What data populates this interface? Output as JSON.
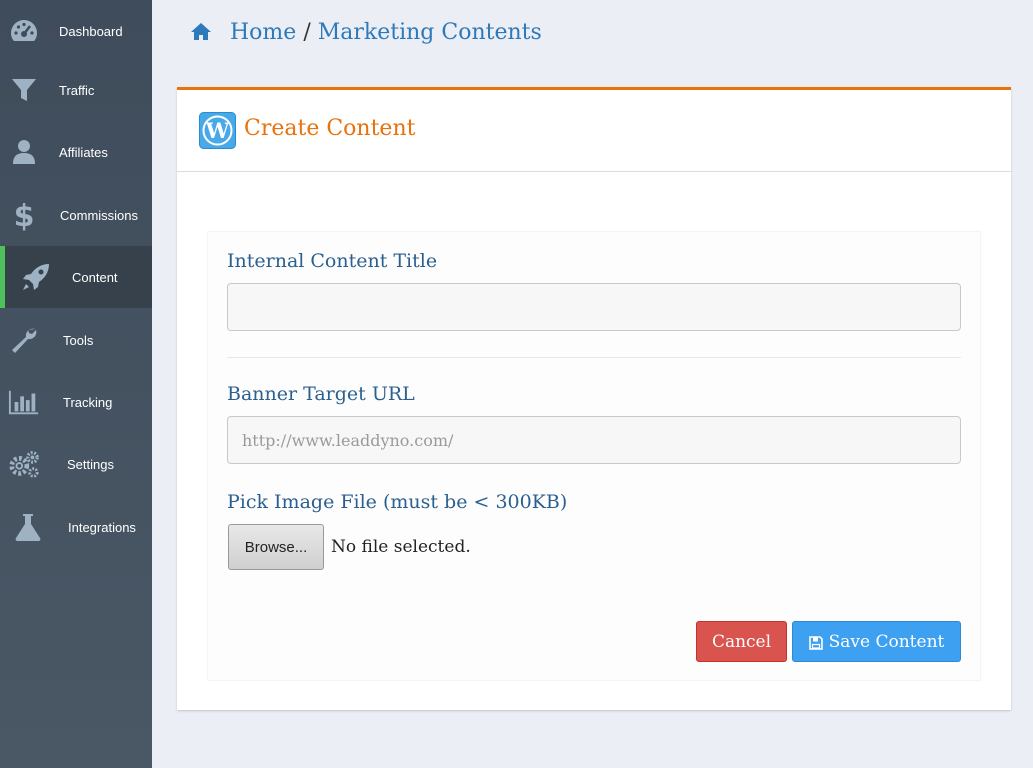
{
  "sidebar": {
    "items": [
      {
        "label": "Dashboard",
        "icon": "dashboard-icon"
      },
      {
        "label": "Traffic",
        "icon": "filter-icon"
      },
      {
        "label": "Affiliates",
        "icon": "user-icon"
      },
      {
        "label": "Commissions",
        "icon": "dollar-icon"
      },
      {
        "label": "Content",
        "icon": "rocket-icon",
        "active": true
      },
      {
        "label": "Tools",
        "icon": "wrench-icon"
      },
      {
        "label": "Tracking",
        "icon": "bar-chart-icon"
      },
      {
        "label": "Settings",
        "icon": "gears-icon"
      },
      {
        "label": "Integrations",
        "icon": "flask-icon"
      }
    ]
  },
  "breadcrumb": {
    "home": "Home",
    "separator": "/",
    "current": "Marketing Contents"
  },
  "card": {
    "title": "Create Content",
    "logo": "wordpress-logo-icon"
  },
  "form": {
    "title_label": "Internal Content Title",
    "title_value": "",
    "url_label": "Banner Target URL",
    "url_placeholder": "http://www.leaddyno.com/",
    "image_label": "Pick Image File (must be < 300KB)",
    "browse_label": "Browse...",
    "file_status": "No file selected."
  },
  "actions": {
    "cancel_label": "Cancel",
    "save_label": "Save Content"
  },
  "colors": {
    "accent": "#e8720c",
    "link": "#2e79b9",
    "active_marker": "#4cc15c",
    "cancel": "#d9534f",
    "save": "#3ea0f0"
  }
}
